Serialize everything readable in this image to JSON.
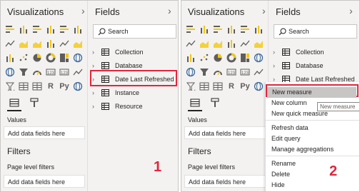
{
  "visualizations": {
    "title": "Visualizations",
    "more": "...",
    "values_label": "Values",
    "add_fields": "Add data fields here"
  },
  "filters": {
    "title": "Filters",
    "page_level": "Page level filters",
    "add_fields": "Add data fields here"
  },
  "fields": {
    "title": "Fields",
    "search_placeholder": "Search",
    "tables": [
      "Collection",
      "Database",
      "Date Last Refreshed",
      "Instance",
      "Resource"
    ]
  },
  "context_menu": {
    "items": [
      "New measure",
      "New column",
      "New quick measure",
      "Refresh data",
      "Edit query",
      "Manage aggregations",
      "Rename",
      "Delete",
      "Hide"
    ],
    "tooltip": "New measure"
  },
  "steps": {
    "first": "1",
    "second": "2"
  },
  "colors": {
    "accent_red": "#e1263c",
    "pane_bg": "#f3f2f1",
    "selected_bg": "#c8c6c4"
  },
  "viz_icons": [
    "stacked-bar-icon",
    "stacked-column-icon",
    "clustered-bar-icon",
    "clustered-column-icon",
    "100-bar-icon",
    "100-column-icon",
    "line-chart-icon",
    "area-chart-icon",
    "stacked-area-icon",
    "line-column-icon",
    "line-clustered-icon",
    "ribbon-chart-icon",
    "waterfall-icon",
    "scatter-icon",
    "pie-chart-icon",
    "donut-icon",
    "treemap-icon",
    "map-icon",
    "filled-map-icon",
    "funnel-icon",
    "gauge-icon",
    "card-icon",
    "multi-row-card-icon",
    "kpi-icon",
    "slicer-icon",
    "table-icon",
    "matrix-icon",
    "r-visual-icon",
    "python-visual-icon",
    "arcgis-icon"
  ]
}
